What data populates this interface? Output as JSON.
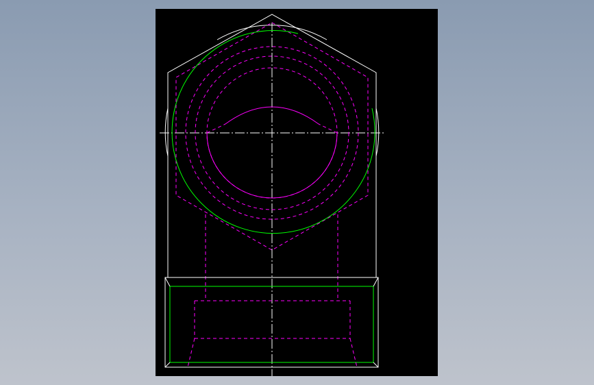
{
  "drawing": {
    "type": "cad-orthographic-view",
    "background_color": "#000000",
    "page_background_top": "#8a9bb1",
    "page_background_bottom": "#bec3cc",
    "colors": {
      "visible_edges": "#ffffff",
      "hidden_edges": "#ff00ff",
      "thread_lines": "#00ff00"
    }
  }
}
